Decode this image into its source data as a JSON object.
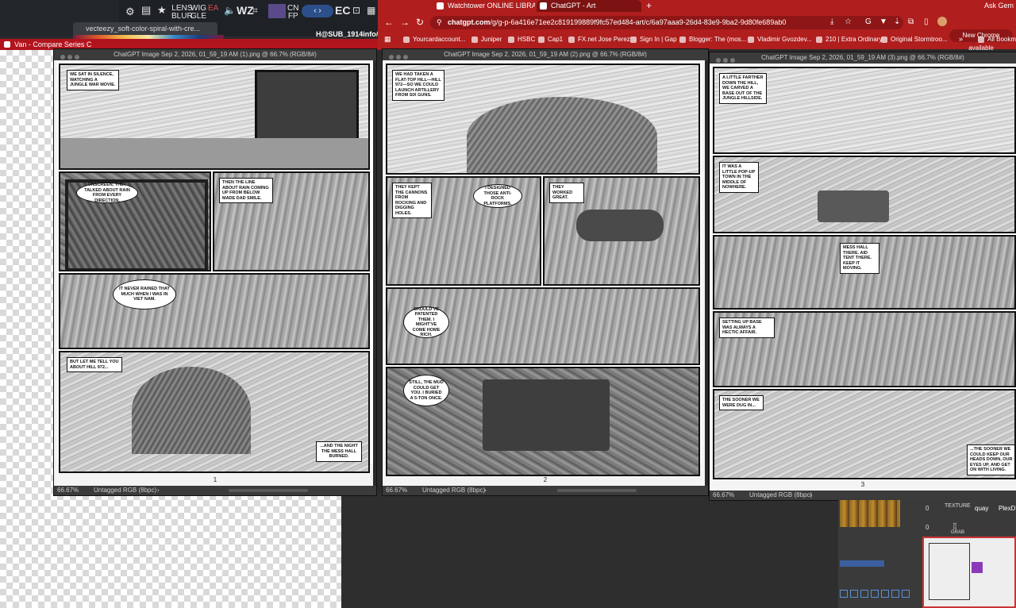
{
  "appstrip": {
    "tools": [
      {
        "name": "gear",
        "label": ""
      },
      {
        "name": "document",
        "label": ""
      },
      {
        "name": "star",
        "label": ""
      },
      {
        "name": "lens-blur",
        "label": "LENS\nBLUR"
      },
      {
        "name": "wiggle",
        "label": "WIG\nGLE"
      },
      {
        "name": "ea",
        "label": "EA"
      },
      {
        "name": "wz",
        "label": "WZ"
      },
      {
        "name": "cnfp",
        "label": "CN\nFP"
      },
      {
        "name": "ec",
        "label": "EC"
      }
    ],
    "spiral_tab": "vecteezy_soft-color-spiral-with-cre...",
    "hsub": "H@SUB_1914info#"
  },
  "van_window": {
    "title": "Van - Compare Series C"
  },
  "browser": {
    "tabs": [
      {
        "label": "Watchtower ONLINE LIBRARY",
        "active": false
      },
      {
        "label": "ChatGPT - Art",
        "active": true
      }
    ],
    "new_tab": "+",
    "ask": "Ask Gem",
    "url_domain": "chatgpt.com",
    "url_path": "/g/g-p-6a416e71ee2c819199889f9fc57ed484-art/c/6a97aaa9-26d4-83e9-9ba2-9d80fe689ab0",
    "chrome_update": "New Chrome available",
    "bookmarks": [
      "Yourcardaccount...",
      "Juniper",
      "HSBC",
      "Cap1",
      "FX.net Jose Perez",
      "Sign In | Gap",
      "Blogger: The (mos...",
      "Vladimir Gvozdev...",
      "210 | Extra Ordinary",
      "Original Stormtroo..."
    ],
    "bookmarks_more": "»",
    "all_bookmarks": "All Bookm"
  },
  "docs": [
    {
      "title": "ChatGPT Image Sep 2, 2026, 01_59_19 AM (1).png @ 66.7% (RGB/8#)",
      "zoom": "66.67%",
      "mode": "Untagged RGB (8bpc)",
      "page": "1",
      "captions": [
        {
          "text": "We sat in silence, watching a jungle war movie."
        },
        {
          "text": "Then the line about rain coming up from below made dad smile."
        },
        {
          "text": "But let me tell you about Hill 972..."
        },
        {
          "text": "...and the night the mess hall burned."
        }
      ],
      "bubbles": [
        {
          "text": "Onscreen, they talked about rain from every direction."
        },
        {
          "text": "It never rained that much when I was in Viet Nam."
        }
      ]
    },
    {
      "title": "ChatGPT Image Sep 2, 2026, 01_59_19 AM (2).png @ 66.7% (RGB/8#)",
      "zoom": "66.67%",
      "mode": "Untagged RGB (8bpc)",
      "page": "2",
      "captions": [
        {
          "text": "We had taken a flat-top hill—Hill 972—so we could launch artillery from six guns."
        },
        {
          "text": "They kept the cannons from rocking and digging holes."
        },
        {
          "text": "They worked great."
        }
      ],
      "bubbles": [
        {
          "text": "I designed those anti-rock platforms."
        },
        {
          "text": "Should've patented them. I might've come home rich."
        },
        {
          "text": "Still, the mud could get you. I buried a 5-ton once."
        }
      ]
    },
    {
      "title": "ChatGPT Image Sep 2, 2026, 01_59_19 AM (3).png @ 66.7% (RGB/8#)",
      "zoom": "66.67%",
      "mode": "Untagged RGB (8bpc)",
      "page": "3",
      "captions": [
        {
          "text": "A little farther down the hill, we carved a base out of the jungle hillside."
        },
        {
          "text": "It was a little pop-up town in the middle of nowhere."
        },
        {
          "text": "Setting up base was always a hectic affair."
        },
        {
          "text": "The sooner we were dug in..."
        },
        {
          "text": "...the sooner we could keep our heads down, our eyes up, and get on with living."
        }
      ],
      "bubbles": [
        {
          "text": "Mess hall there. Aid tent there. Keep it moving."
        }
      ]
    }
  ],
  "widgets": {
    "texture": "TEXTURE",
    "grab": "GRAB",
    "quay": "quay",
    "plex": "PlexD",
    "zero1": "0",
    "zero2": "0",
    "zero3": "0"
  }
}
